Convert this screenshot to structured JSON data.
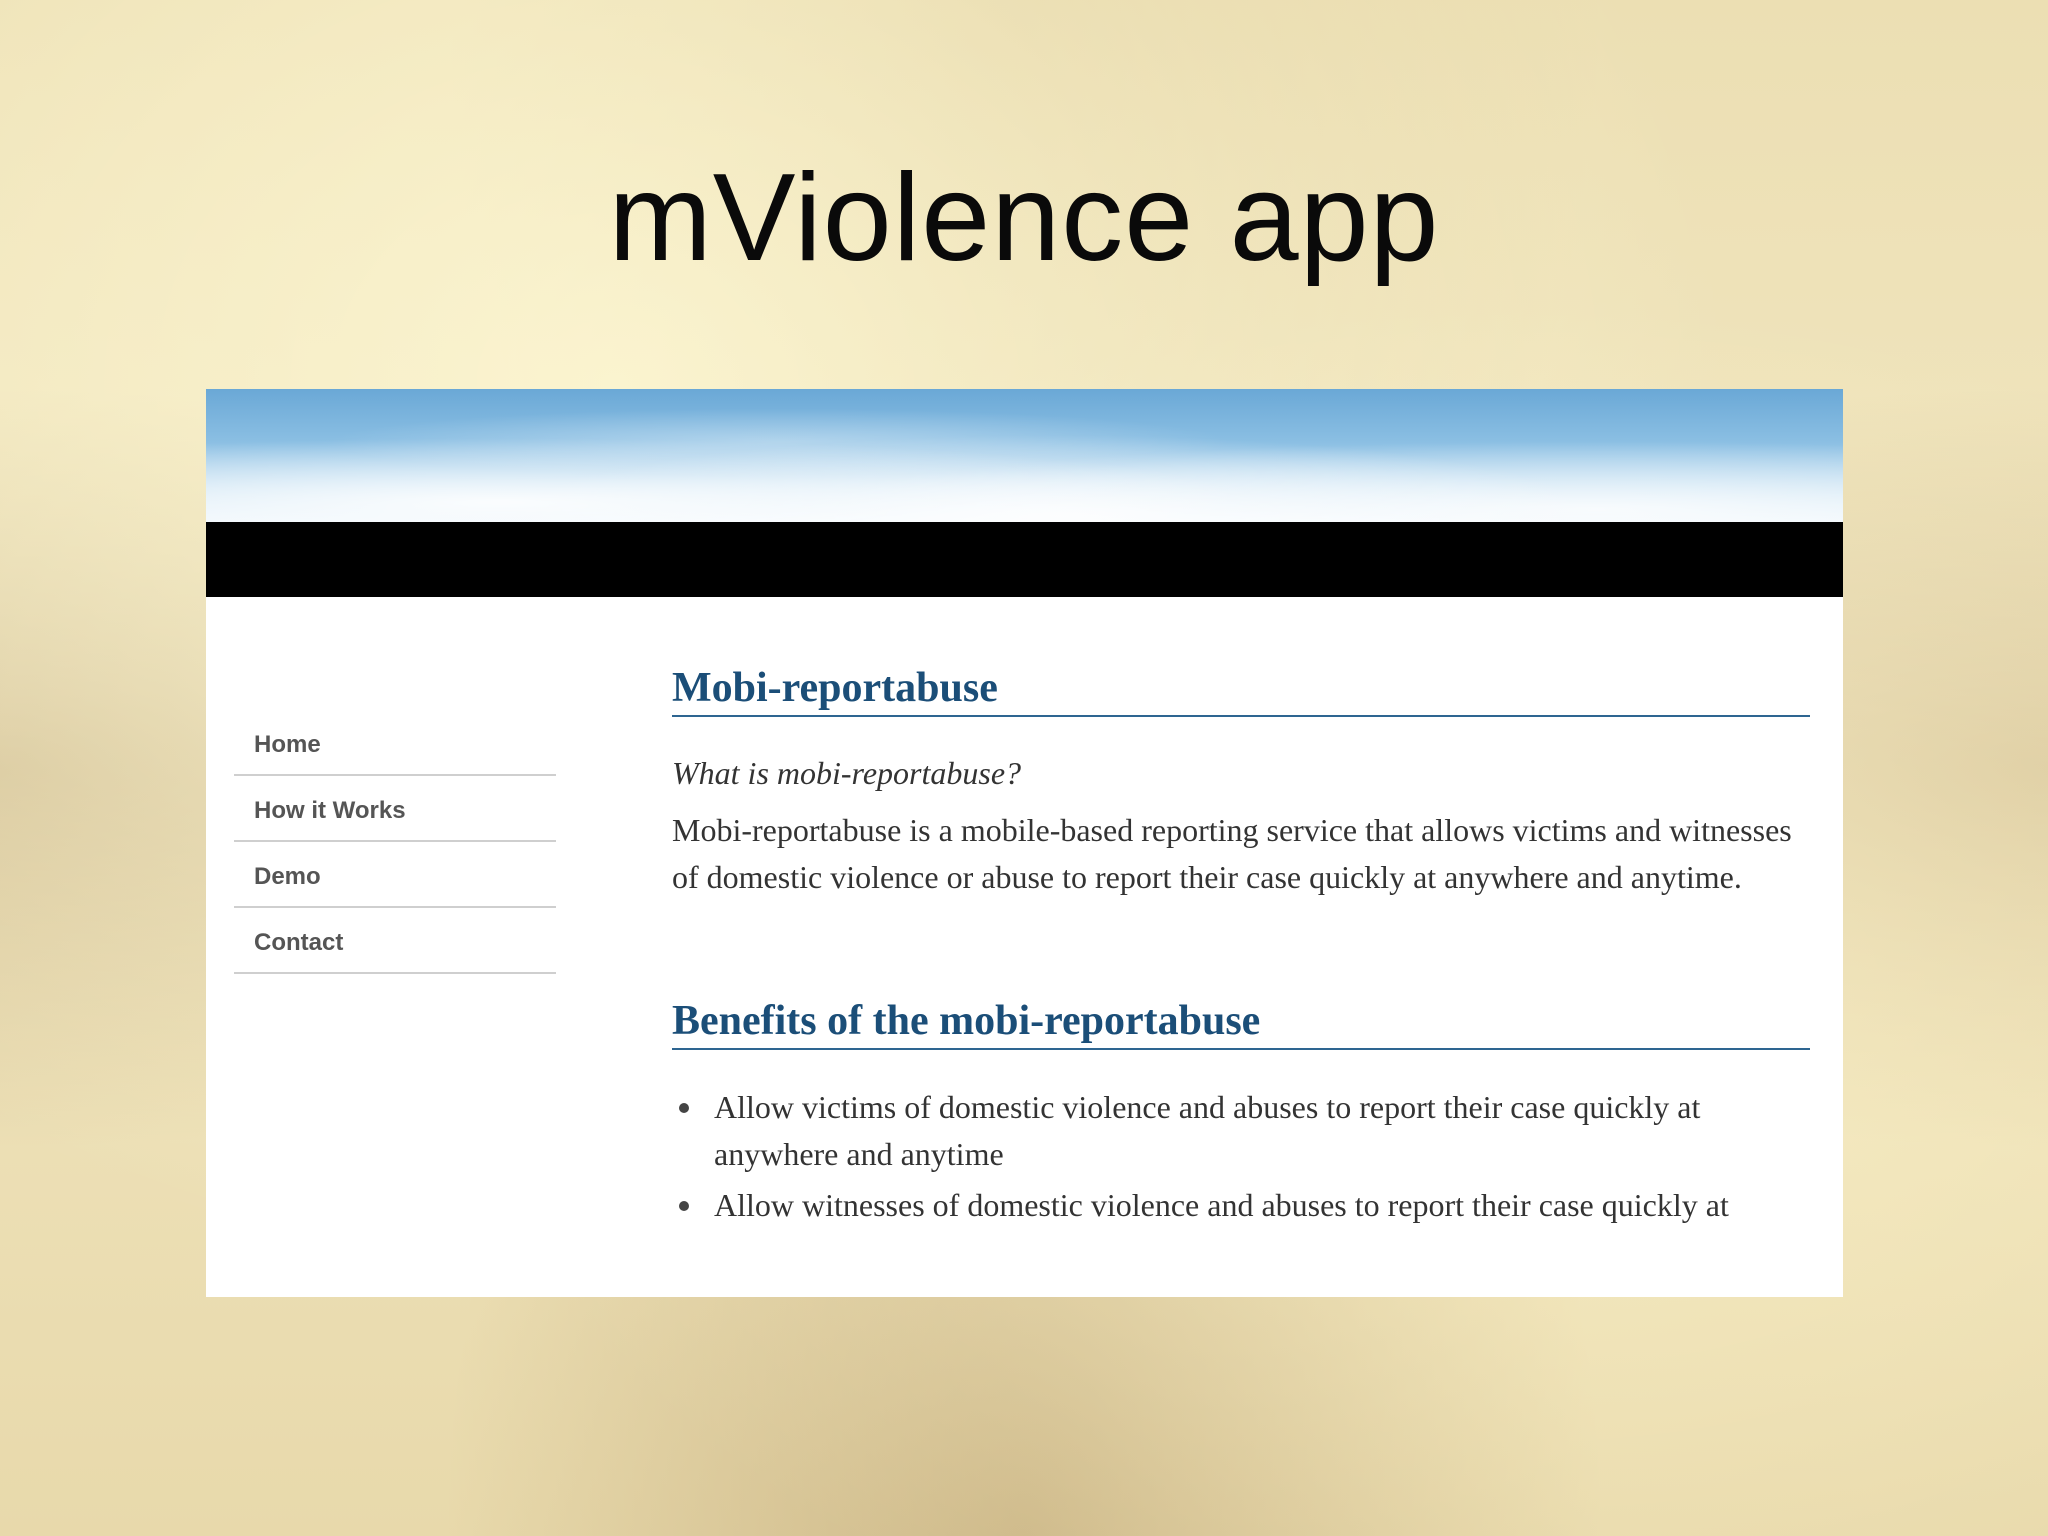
{
  "slide": {
    "title": "mViolence app"
  },
  "website": {
    "nav": {
      "items": [
        {
          "label": "Home"
        },
        {
          "label": "How it Works"
        },
        {
          "label": "Demo"
        },
        {
          "label": "Contact"
        }
      ]
    },
    "main": {
      "section1": {
        "heading": "Mobi-reportabuse",
        "subheading": "What is mobi-reportabuse?",
        "paragraph": "Mobi-reportabuse is a mobile-based reporting service that allows victims and witnesses of domestic violence or abuse to report their case quickly at anywhere and anytime."
      },
      "section2": {
        "heading": "Benefits of the mobi-reportabuse",
        "bullets": [
          "Allow victims of domestic violence and abuses to report their case quickly at anywhere and anytime",
          "Allow witnesses of domestic violence and abuses to report their case quickly at"
        ]
      }
    }
  },
  "colors": {
    "heading": "#1b4e78",
    "nav_text": "#555555",
    "body_text": "#333333",
    "header_bar": "#000000"
  }
}
